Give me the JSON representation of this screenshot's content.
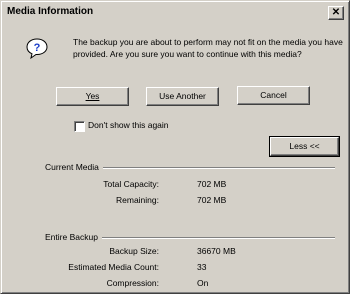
{
  "window": {
    "title": "Media Information",
    "close_glyph": "✕"
  },
  "dialog": {
    "icon": "question-icon",
    "message": "The backup you are about to perform may not fit on the media you have provided.  Are you sure you want to continue with this media?",
    "buttons": {
      "yes": "Yes",
      "use_another": "Use Another",
      "cancel": "Cancel",
      "less": "Less <<"
    },
    "checkbox": {
      "label": "Don't show this again",
      "checked": false
    }
  },
  "current_media": {
    "heading": "Current Media",
    "rows": [
      {
        "label": "Total Capacity:",
        "value": "702 MB"
      },
      {
        "label": "Remaining:",
        "value": "702 MB"
      }
    ]
  },
  "entire_backup": {
    "heading": "Entire Backup",
    "rows": [
      {
        "label": "Backup Size:",
        "value": "36670 MB"
      },
      {
        "label": "Estimated Media Count:",
        "value": "33"
      },
      {
        "label": "Compression:",
        "value": "On"
      }
    ]
  },
  "colors": {
    "face": "#d4d0c8",
    "shadow": "#808080",
    "highlight": "#ffffff",
    "icon_blue": "#1a3cc8"
  }
}
